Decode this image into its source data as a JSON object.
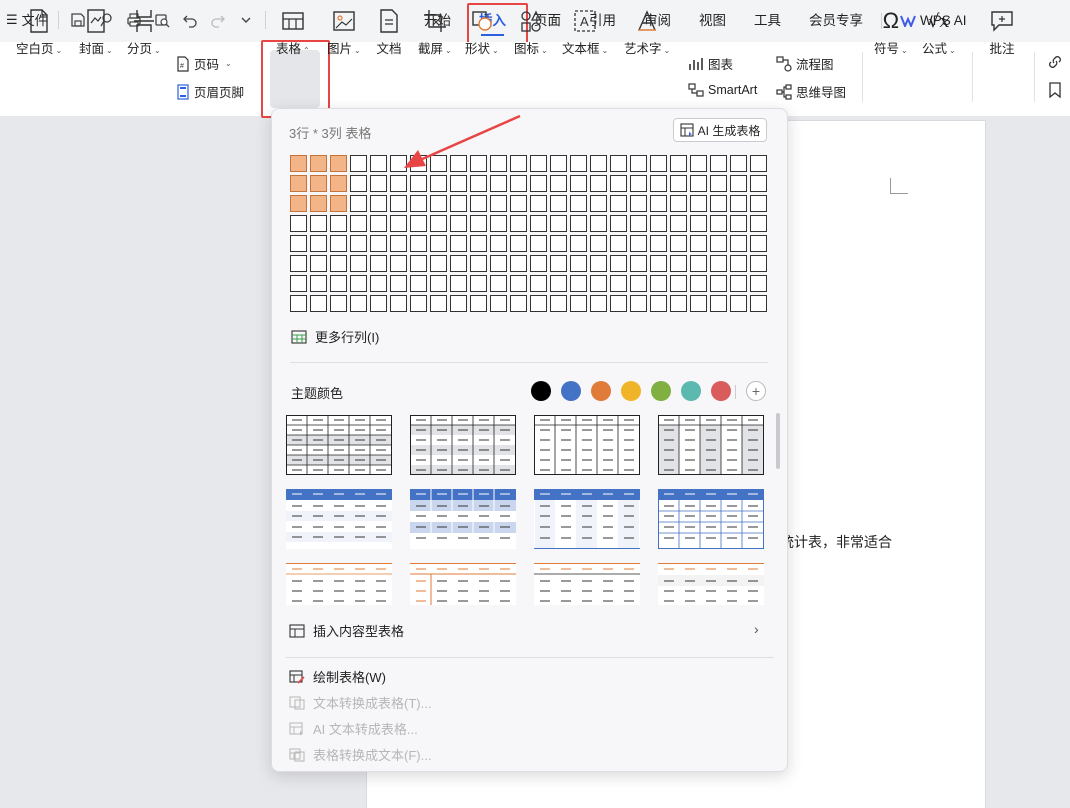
{
  "topbar": {
    "file_label": "文件",
    "tabs": [
      "开始",
      "插入",
      "页面",
      "引用",
      "审阅",
      "视图",
      "工具",
      "会员专享"
    ],
    "active_tab": "插入",
    "wps_ai_label": "WPS AI"
  },
  "ribbon": {
    "blank_page": "空白页",
    "cover": "封面",
    "section_break": "分页",
    "page_number": "页码",
    "header_footer": "页眉页脚",
    "table": "表格",
    "picture": "图片",
    "document": "文档",
    "screenshot": "截屏",
    "shape": "形状",
    "icon": "图标",
    "textbox": "文本框",
    "wordart": "艺术字",
    "chart": "图表",
    "smartart": "SmartArt",
    "flowchart": "流程图",
    "mindmap": "思维导图",
    "symbol": "符号",
    "formula": "公式",
    "comment": "批注"
  },
  "document": {
    "visible_text": "统计表，非常适合"
  },
  "table_panel": {
    "title": "3行 * 3列 表格",
    "ai_button": "AI 生成表格",
    "grid_rows": 8,
    "grid_cols": 24,
    "selected_rows": 3,
    "selected_cols": 3,
    "more_rows_cols": "更多行列(I)",
    "theme_color_label": "主题颜色",
    "theme_colors": [
      "#000000",
      "#4472c4",
      "#e07b39",
      "#f0b429",
      "#7fb041",
      "#5bb9b0",
      "#d95b5b"
    ],
    "insert_content_table": "插入内容型表格",
    "draw_table": "绘制表格(W)",
    "text_to_table": "文本转换成表格(T)...",
    "ai_text_to_table": "AI 文本转成表格...",
    "table_to_text": "表格转换成文本(F)..."
  }
}
